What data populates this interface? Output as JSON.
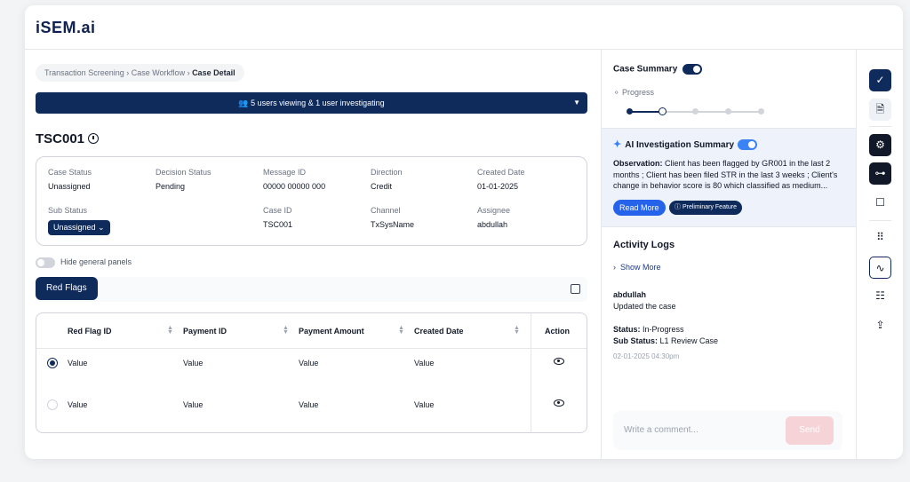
{
  "brand": {
    "logo_text": "iSEM.ai"
  },
  "breadcrumb": {
    "path": "Transaction Screening › Case Workflow › ",
    "current": "Case Detail"
  },
  "viewers": {
    "text": "5 users viewing & 1 user investigating",
    "caret": "▼"
  },
  "case": {
    "title": "TSC001"
  },
  "info": {
    "case_status_label": "Case Status",
    "case_status": "Unassigned",
    "decision_status_label": "Decision Status",
    "decision_status": "Pending",
    "message_id_label": "Message ID",
    "message_id": "00000 00000 000",
    "direction_label": "Direction",
    "direction": "Credit",
    "created_date_label": "Created Date",
    "created_date": "01-01-2025",
    "sub_status_label": "Sub Status",
    "sub_status": "Unassigned ⌄",
    "case_id_label": "Case ID",
    "case_id": "TSC001",
    "channel_label": "Channel",
    "channel": "TxSysName",
    "assignee_label": "Assignee",
    "assignee": "abdullah"
  },
  "panels_toggle": {
    "label": "Hide general panels"
  },
  "red_flags": {
    "button": "Red Flags",
    "columns": [
      "Red Flag ID",
      "Payment ID",
      "Payment Amount",
      "Created Date",
      "Action"
    ],
    "rows": [
      {
        "id": "Value",
        "payment_id": "Value",
        "amount": "Value",
        "created": "Value"
      },
      {
        "id": "Value",
        "payment_id": "Value",
        "amount": "Value",
        "created": "Value"
      }
    ]
  },
  "summary": {
    "title": "Case Summary",
    "progress_label": "Progress",
    "progress_steps": 5,
    "progress_current": 2,
    "ai_title": "AI Investigation Summary",
    "observation_label": "Observation:",
    "observation_text": "Client has been flagged by GR001 in the last 2 months ; Client has been filed STR in the last 3 weeks ; Client's change in behavior score is 80 which classified as medium...",
    "read_more": "Read More",
    "preliminary": "Preliminary Feature"
  },
  "activity": {
    "title": "Activity Logs",
    "show_more": "Show More",
    "user": "abdullah",
    "action": "Updated the case",
    "status_label": "Status:",
    "status": "In-Progress",
    "sub_status_label": "Sub Status:",
    "sub_status": "L1 Review Case",
    "timestamp": "02-01-2025 04:30pm"
  },
  "comment": {
    "placeholder": "Write a comment...",
    "send": "Send"
  },
  "rail_icons": [
    "check-icon",
    "document-lock-icon",
    "settings-nodes-icon",
    "hierarchy-icon",
    "comment-icon",
    "grid-icon",
    "activity-icon",
    "report-icon",
    "share-icon"
  ],
  "colors": {
    "navy": "#0f2b5c",
    "accent": "#2563eb",
    "ai_bg": "#eef2fb",
    "send_disabled": "#f6d3d7"
  }
}
